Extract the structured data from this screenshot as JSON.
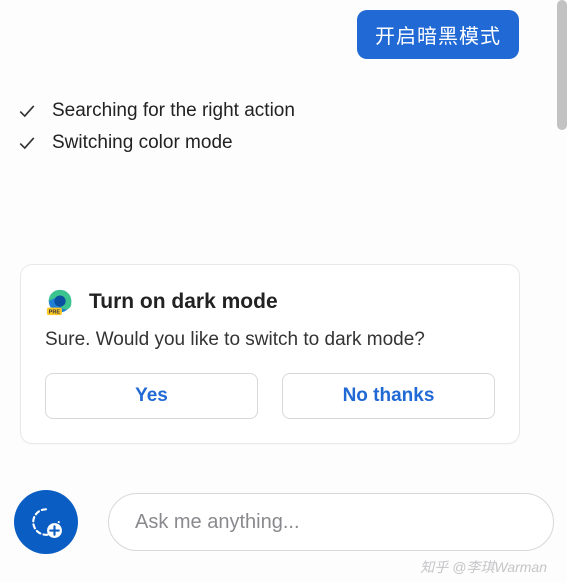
{
  "user_message": "开启暗黑模式",
  "status_items": [
    "Searching for the right action",
    "Switching color mode"
  ],
  "confirm_card": {
    "title": "Turn on dark mode",
    "body": "Sure. Would you like to switch to dark mode?",
    "yes_label": "Yes",
    "no_label": "No thanks"
  },
  "input_placeholder": "Ask me anything...",
  "watermark": "知乎 @李琪Warman",
  "colors": {
    "brand_blue": "#2169d4",
    "fab_blue": "#0a5dc2",
    "link_blue": "#2169d4"
  }
}
